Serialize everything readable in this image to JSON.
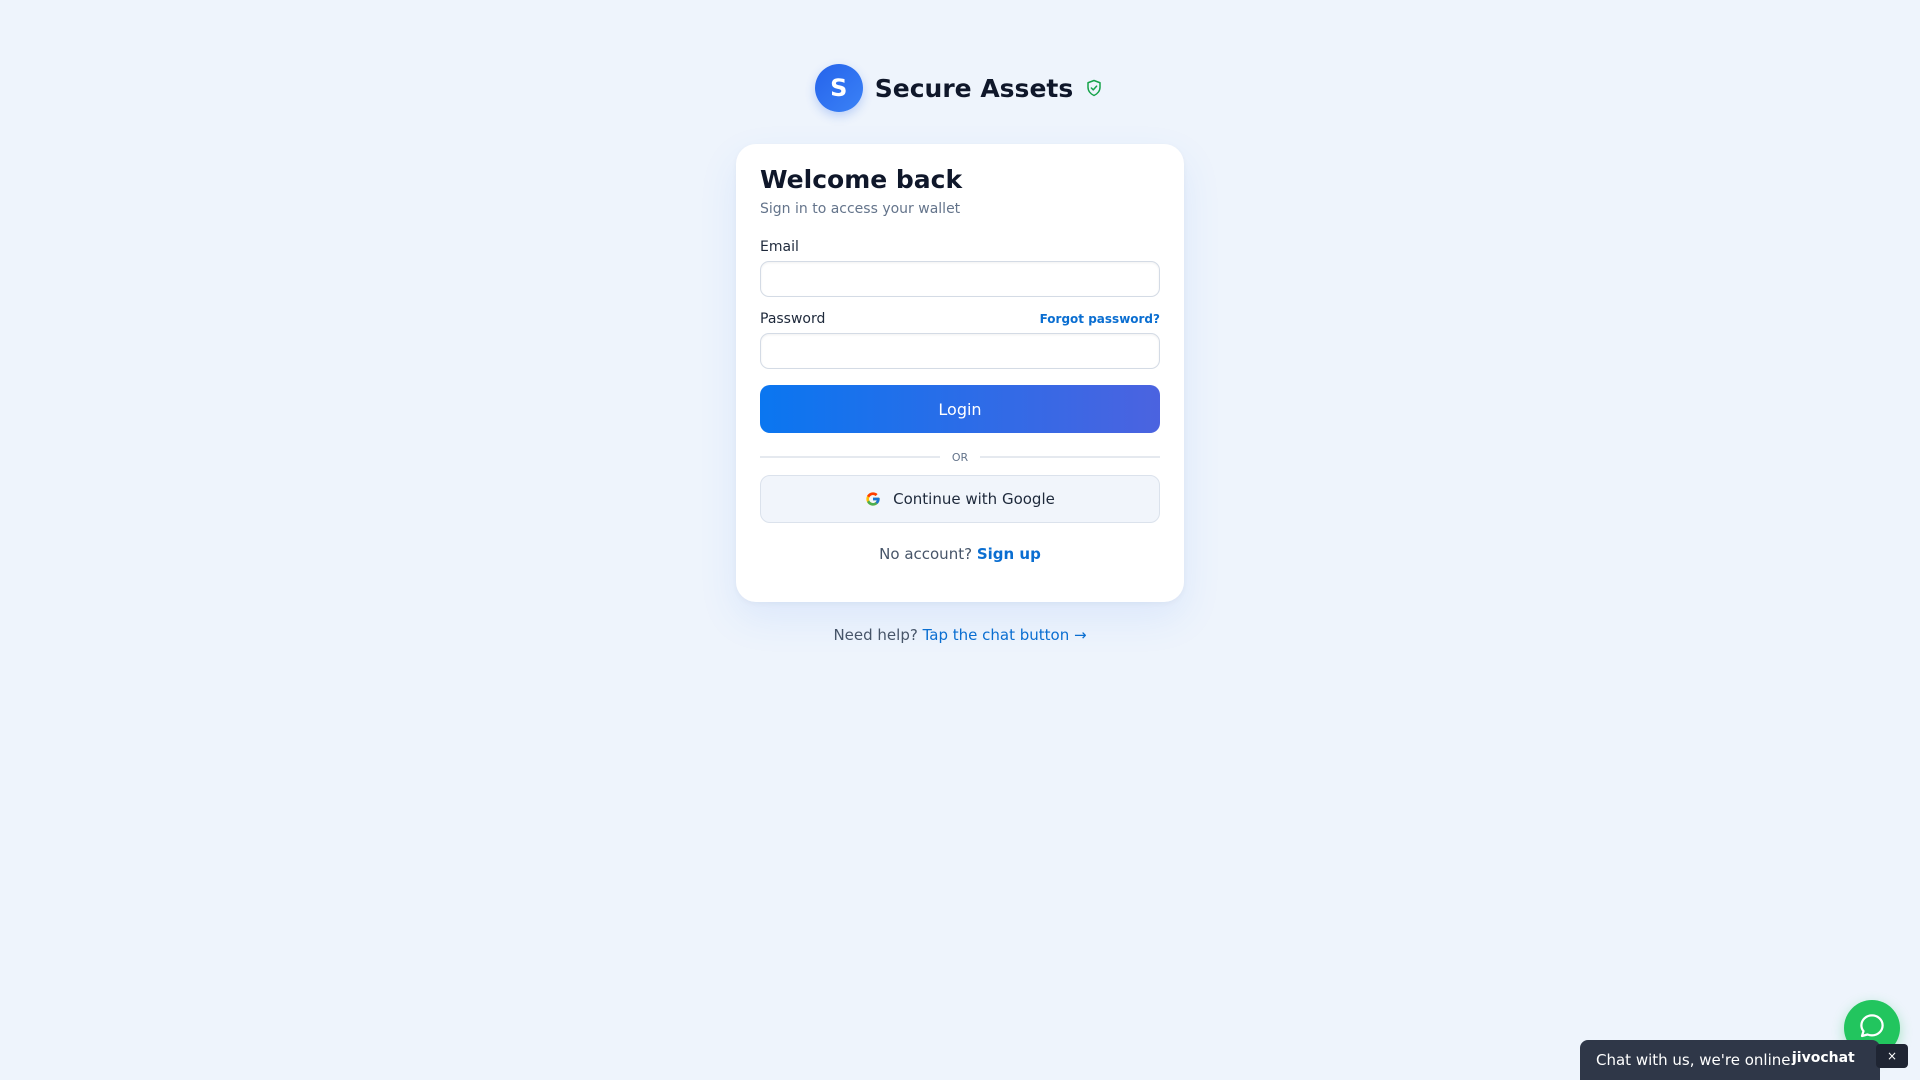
{
  "brand": {
    "logo_letter": "S",
    "name": "Secure Assets",
    "logo_color": "#2563eb",
    "verified_icon": "shield-check-icon",
    "verified_color": "#16a34a"
  },
  "card": {
    "title": "Welcome back",
    "subtitle": "Sign in to access your wallet",
    "email_label": "Email",
    "email_value": "",
    "password_label": "Password",
    "password_value": "",
    "forgot_label": "Forgot password?",
    "login_label": "Login",
    "divider_label": "OR",
    "google_label": "Continue with Google",
    "no_account_text": "No account?",
    "signup_label": "Sign up"
  },
  "help": {
    "text": "Need help?",
    "link": "Tap the chat button →"
  },
  "chat": {
    "fab_icon": "chat-bubble-icon",
    "fab_color": "#22c55e",
    "bar_text": "Chat with us, we're online!",
    "brand": "jivochat",
    "close": "×"
  },
  "colors": {
    "accent": "#0a76f0",
    "link": "#0a6ed1",
    "background": "#eef4fc"
  }
}
